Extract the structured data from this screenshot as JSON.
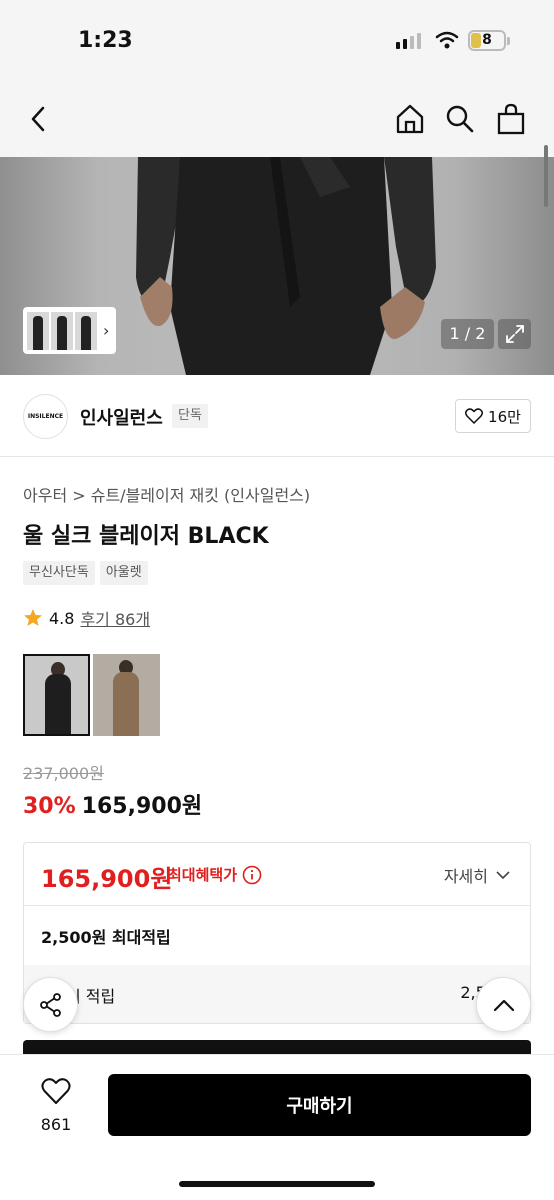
{
  "status": {
    "time": "1:23",
    "battery": "8"
  },
  "product_image": {
    "page_indicator": "1 / 2"
  },
  "brand": {
    "logo_text": "INSILENCE",
    "name": "인사일런스",
    "badge": "단독",
    "likes": "16만"
  },
  "product": {
    "breadcrumb": "아우터 > 슈트/블레이저 재킷 (인사일런스)",
    "title": "울 실크 블레이저 BLACK",
    "tags": [
      "무신사단독",
      "아울렛"
    ],
    "rating": "4.8",
    "review_link": "후기 86개",
    "colors": [
      "BLACK",
      "BROWN"
    ],
    "original_price": "237,000원",
    "discount": "30%",
    "sale_price": "165,900원"
  },
  "benefit": {
    "max_price": "165,900원",
    "max_label": "최대혜택가",
    "detail_label": "자세히",
    "points": "2,500원 최대적립",
    "row3_left": "기 적립",
    "row3_right": "2,5("
  },
  "bottom": {
    "wish_count": "861",
    "buy_label": "구매하기"
  },
  "colors": {
    "discount": "#e02020",
    "buy_button": "#000000"
  }
}
